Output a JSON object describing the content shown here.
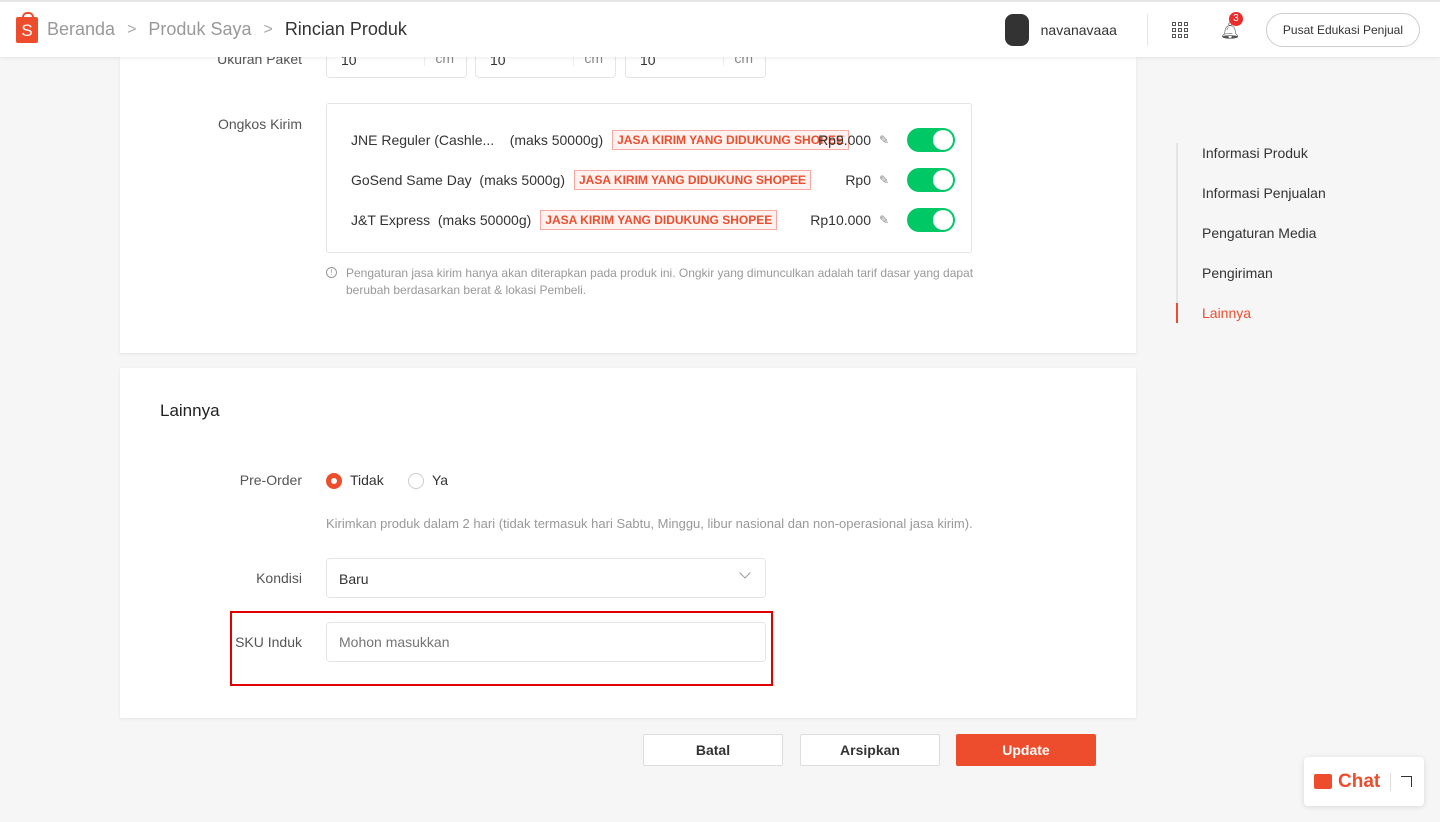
{
  "header": {
    "breadcrumb": [
      "Beranda",
      "Produk Saya",
      "Rincian Produk"
    ],
    "logo_text": "S",
    "username": "navanavaaa",
    "notification_count": "3",
    "edu_button": "Pusat Edukasi Penjual"
  },
  "package": {
    "label": "Ukuran Paket",
    "fields": [
      {
        "value": "10",
        "unit": "cm"
      },
      {
        "value": "10",
        "unit": "cm"
      },
      {
        "value": "10",
        "unit": "cm"
      }
    ]
  },
  "shipping": {
    "label": "Ongkos Kirim",
    "tag": "JASA KIRIM YANG DIDUKUNG SHOPEE",
    "couriers": [
      {
        "name": "JNE Reguler (Cashle...",
        "max": "(maks 50000g)",
        "price": "Rp9.000",
        "enabled": true
      },
      {
        "name": "GoSend Same Day",
        "max": "(maks 5000g)",
        "price": "Rp0",
        "enabled": true
      },
      {
        "name": "J&T Express",
        "max": "(maks 50000g)",
        "price": "Rp10.000",
        "enabled": true
      }
    ],
    "note": "Pengaturan jasa kirim hanya akan diterapkan pada produk ini. Ongkir yang dimunculkan adalah tarif dasar yang dapat berubah berdasarkan berat & lokasi Pembeli."
  },
  "other": {
    "title": "Lainnya",
    "preorder_label": "Pre-Order",
    "option_no": "Tidak",
    "option_yes": "Ya",
    "selected": "Tidak",
    "preorder_hint": "Kirimkan produk dalam 2 hari (tidak termasuk hari Sabtu, Minggu, libur nasional dan non-operasional jasa kirim).",
    "condition_label": "Kondisi",
    "condition_value": "Baru",
    "sku_label": "SKU Induk",
    "sku_placeholder": "Mohon masukkan",
    "sku_value": ""
  },
  "actions": {
    "cancel": "Batal",
    "archive": "Arsipkan",
    "update": "Update"
  },
  "side_nav": {
    "items": [
      "Informasi Produk",
      "Informasi Penjualan",
      "Pengaturan Media",
      "Pengiriman",
      "Lainnya"
    ],
    "active": "Lainnya"
  },
  "chat": {
    "label": "Chat"
  },
  "colors": {
    "brand": "#ee4d2d",
    "toggle_on": "#00c864",
    "highlight": "#e00000"
  }
}
